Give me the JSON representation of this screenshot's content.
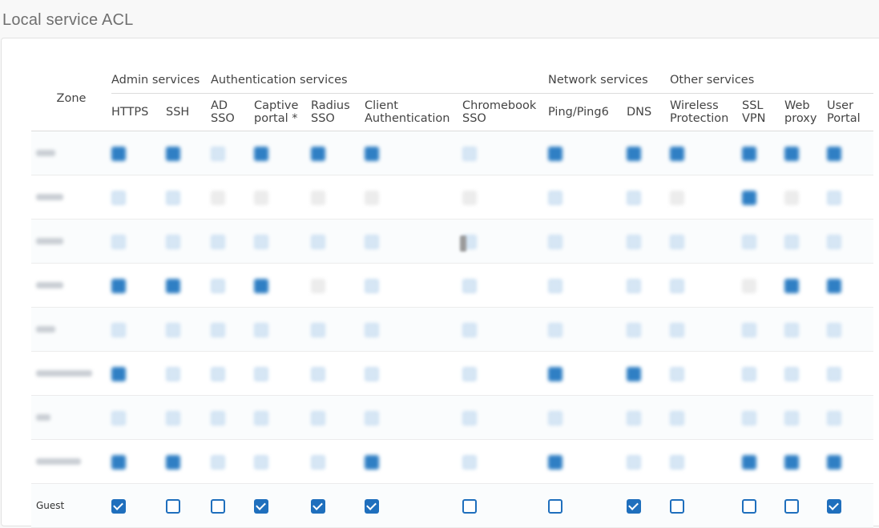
{
  "page": {
    "title": "Local service ACL"
  },
  "table": {
    "zone_header": "Zone",
    "groups": [
      {
        "label": "Admin services",
        "span": 2
      },
      {
        "label": "Authentication services",
        "span": 5
      },
      {
        "label": "Network services",
        "span": 2
      },
      {
        "label": "Other services",
        "span": 4
      }
    ],
    "columns": [
      [
        "HTTPS"
      ],
      [
        "SSH"
      ],
      [
        "AD",
        "SSO"
      ],
      [
        "Captive",
        "portal *"
      ],
      [
        "Radius",
        "SSO"
      ],
      [
        "Client",
        "Authentication"
      ],
      [
        "Chromebook",
        "SSO"
      ],
      [
        "Ping/Ping6"
      ],
      [
        "DNS"
      ],
      [
        "Wireless",
        "Protection"
      ],
      [
        "SSL",
        "VPN"
      ],
      [
        "Web",
        "proxy"
      ],
      [
        "User",
        "Portal"
      ]
    ],
    "rows": [
      {
        "zone": "",
        "cells": [
          "on",
          "on",
          "off",
          "on",
          "on",
          "on",
          "off",
          "on",
          "on",
          "on",
          "on",
          "on",
          "on"
        ]
      },
      {
        "zone": "",
        "cells": [
          "off",
          "off",
          "dis",
          "dis",
          "dis",
          "dis",
          "dis",
          "off",
          "off",
          "dis",
          "on",
          "dis",
          "off"
        ]
      },
      {
        "zone": "",
        "cells": [
          "off",
          "off",
          "off",
          "off",
          "off",
          "off",
          "off",
          "off",
          "off",
          "off",
          "off",
          "off",
          "off"
        ]
      },
      {
        "zone": "",
        "cells": [
          "on",
          "on",
          "off",
          "on",
          "dis",
          "off",
          "off",
          "off",
          "off",
          "off",
          "dis",
          "on",
          "on"
        ]
      },
      {
        "zone": "",
        "cells": [
          "off",
          "off",
          "off",
          "off",
          "off",
          "off",
          "off",
          "off",
          "off",
          "off",
          "off",
          "off",
          "off"
        ]
      },
      {
        "zone": "",
        "cells": [
          "on",
          "off",
          "off",
          "off",
          "off",
          "off",
          "off",
          "on",
          "on",
          "off",
          "off",
          "off",
          "off"
        ]
      },
      {
        "zone": "",
        "cells": [
          "off",
          "off",
          "off",
          "off",
          "off",
          "off",
          "off",
          "off",
          "off",
          "off",
          "off",
          "off",
          "off"
        ]
      },
      {
        "zone": "",
        "cells": [
          "on",
          "on",
          "off",
          "off",
          "off",
          "on",
          "off",
          "on",
          "off",
          "off",
          "on",
          "on",
          "on"
        ]
      },
      {
        "zone": "Guest",
        "cells": [
          true,
          false,
          false,
          true,
          true,
          true,
          false,
          false,
          true,
          false,
          false,
          false,
          true
        ]
      }
    ]
  }
}
